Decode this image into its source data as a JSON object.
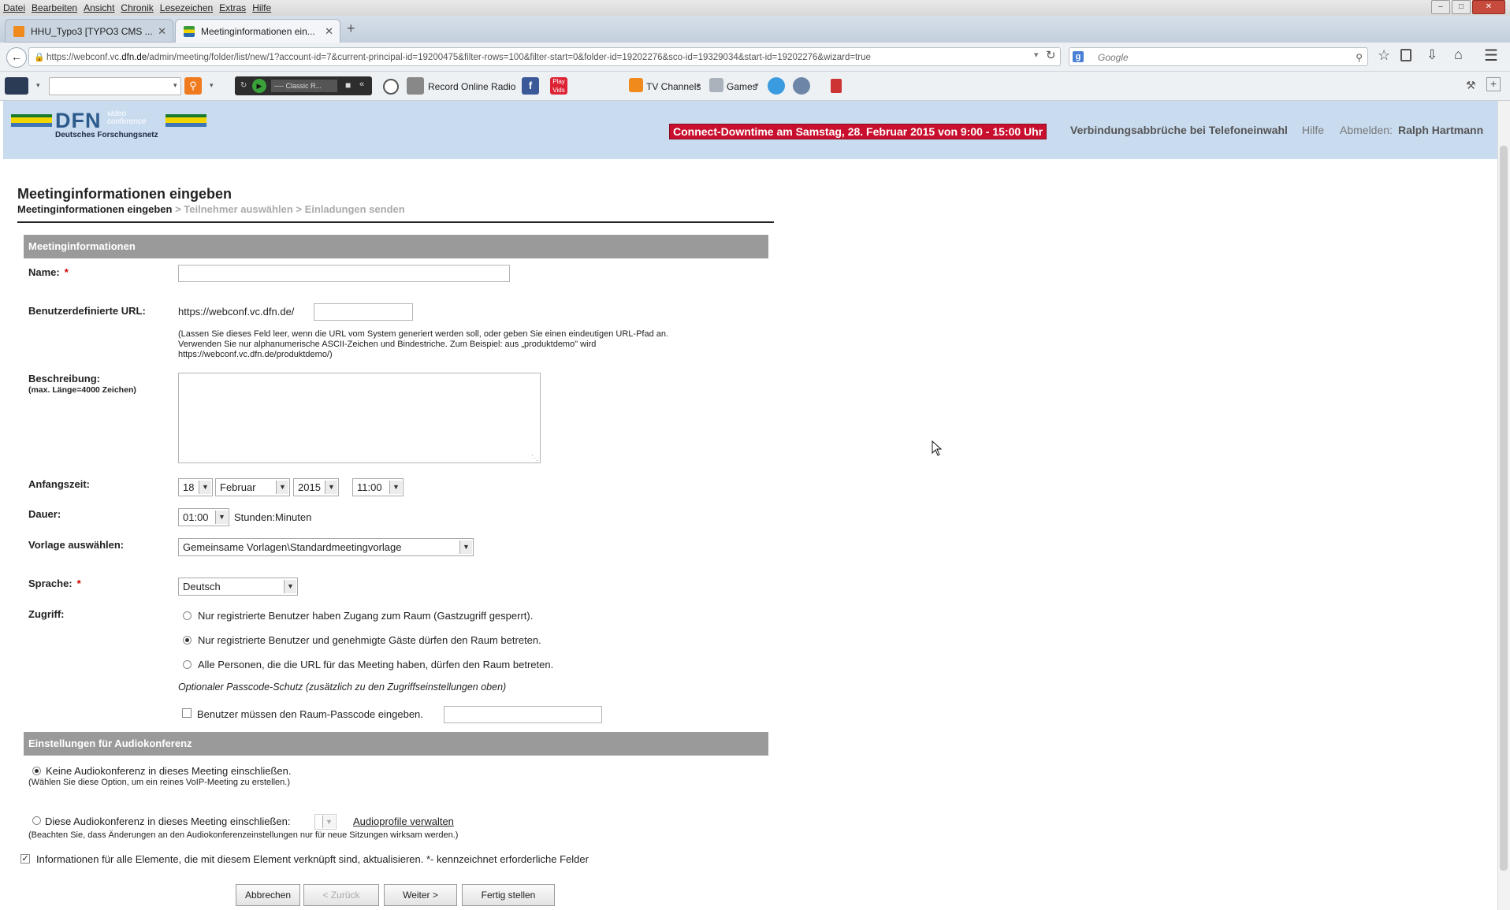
{
  "browser": {
    "menu": [
      "Datei",
      "Bearbeiten",
      "Ansicht",
      "Chronik",
      "Lesezeichen",
      "Extras",
      "Hilfe"
    ],
    "tabs": [
      {
        "label": "HHU_Typo3 [TYPO3 CMS ...",
        "active": false
      },
      {
        "label": "Meetinginformationen ein...",
        "active": true
      }
    ],
    "url_pre": "https://webconf.vc.",
    "url_host": "dfn.de",
    "url_post": "/admin/meeting/folder/list/new/1?account-id=7&current-principal-id=19200475&filter-rows=100&filter-start=0&folder-id=19202276&sco-id=19329034&start-id=19202276&wizard=true",
    "search_placeholder": "Google",
    "toolbar": {
      "radio_station": "---- Classic R...",
      "record_radio": "Record Online Radio",
      "tv_channels": "TV Channels",
      "games": "Games"
    }
  },
  "header": {
    "logo_text": "DFN",
    "logo_tagline": "video conference",
    "logo_org": "Deutsches Forschungsnetz",
    "alert": "Connect-Downtime am Samstag, 28. Februar 2015 von 9:00 - 15:00 Uhr",
    "link_dropout": "Verbindungsabbrüche bei Telefoneinwahl",
    "link_help": "Hilfe",
    "logout_label": "Abmelden:",
    "user_name": "Ralph Hartmann"
  },
  "page": {
    "title": "Meetinginformationen eingeben",
    "breadcrumb": {
      "step1": "Meetinginformationen eingeben",
      "step2": "> Teilnehmer auswählen",
      "step3": "> Einladungen senden"
    }
  },
  "form": {
    "section_meeting": "Meetinginformationen",
    "name_label": "Name:",
    "required_mark": "*",
    "name_value": "",
    "url_label": "Benutzerdefinierte URL:",
    "url_prefix": "https://webconf.vc.dfn.de/",
    "url_value": "",
    "url_help_1": "(Lassen Sie dieses Feld leer, wenn die URL vom System generiert werden soll, oder geben Sie einen eindeutigen URL-Pfad an.",
    "url_help_2": "Verwenden Sie nur alphanumerische ASCII-Zeichen und Bindestriche. Zum Beispiel: aus „produktdemo\" wird",
    "url_help_3": "https://webconf.vc.dfn.de/produktdemo/)",
    "desc_label": "Beschreibung:",
    "desc_hint": "(max. Länge=4000 Zeichen)",
    "desc_value": "",
    "start_label": "Anfangszeit:",
    "start_day": "18",
    "start_month": "Februar",
    "start_year": "2015",
    "start_time": "11:00",
    "duration_label": "Dauer:",
    "duration_value": "01:00",
    "duration_unit": "Stunden:Minuten",
    "template_label": "Vorlage auswählen:",
    "template_value": "Gemeinsame Vorlagen\\Standardmeetingvorlage",
    "language_label": "Sprache:",
    "language_value": "Deutsch",
    "access_label": "Zugriff:",
    "access_options": [
      {
        "label": "Nur registrierte Benutzer haben Zugang zum Raum (Gastzugriff gesperrt).",
        "selected": false
      },
      {
        "label": "Nur registrierte Benutzer und genehmigte Gäste dürfen den Raum betreten.",
        "selected": true
      },
      {
        "label": "Alle Personen, die die URL für das Meeting haben, dürfen den Raum betreten.",
        "selected": false
      }
    ],
    "passcode_note": "Optionaler Passcode-Schutz (zusätzlich zu den Zugriffseinstellungen oben)",
    "passcode_label": "Benutzer müssen den Raum-Passcode eingeben.",
    "passcode_checked": false,
    "section_audio": "Einstellungen für Audiokonferenz",
    "audio_none_label": "Keine Audiokonferenz in dieses Meeting einschließen.",
    "audio_none_hint": "(Wählen Sie diese Option, um ein reines VoIP-Meeting zu erstellen.)",
    "audio_include_label": "Diese Audiokonferenz in dieses Meeting einschließen:",
    "audio_profiles_link": "Audioprofile verwalten",
    "audio_include_hint": "(Beachten Sie, dass Änderungen an den Audiokonferenzeinstellungen nur für neue Sitzungen wirksam werden.)",
    "update_all_label": "Informationen für alle Elemente, die mit diesem Element verknüpft sind, aktualisieren.",
    "required_note": "*- kennzeichnet erforderliche Felder",
    "update_all_checked": true
  },
  "buttons": {
    "cancel": "Abbrechen",
    "back": "< Zurück",
    "next": "Weiter >",
    "finish": "Fertig stellen"
  },
  "colors": {
    "banner": "#c9dbef",
    "alert_bg": "#c8102e",
    "section_bg": "#9a9a9a"
  }
}
